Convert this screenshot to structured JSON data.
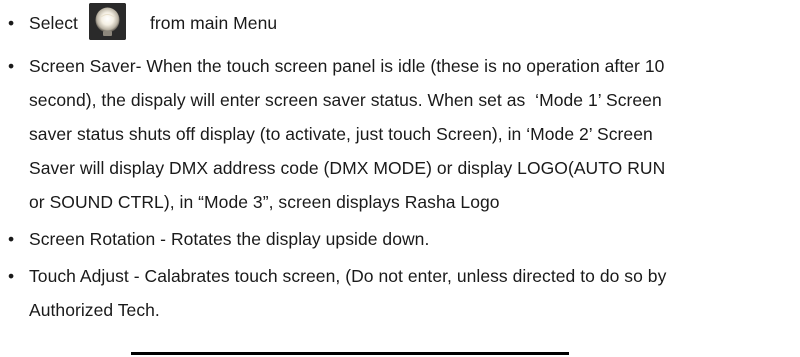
{
  "bullets": {
    "b1": {
      "before_icon": "Select",
      "after_icon": "from main Menu",
      "icon": "bulb-icon"
    },
    "b2": {
      "lines": [
        "Screen Saver- When the touch screen panel is idle (these is no operation after 10",
        "second), the dispaly will enter screen saver status. When set as  ‘Mode 1’ Screen",
        "saver status shuts off display (to activate, just touch Screen), in ‘Mode 2’ Screen",
        "Saver will display DMX address code (DMX MODE) or display LOGO(AUTO RUN",
        "or SOUND CTRL), in “Mode 3”, screen displays Rasha Logo"
      ]
    },
    "b3": {
      "text": "Screen Rotation - Rotates the display upside down."
    },
    "b4": {
      "lines": [
        "Touch Adjust - Calabrates touch screen, (Do not enter, unless directed to do so by",
        "Authorized Tech."
      ]
    }
  },
  "bullet_char": "•"
}
